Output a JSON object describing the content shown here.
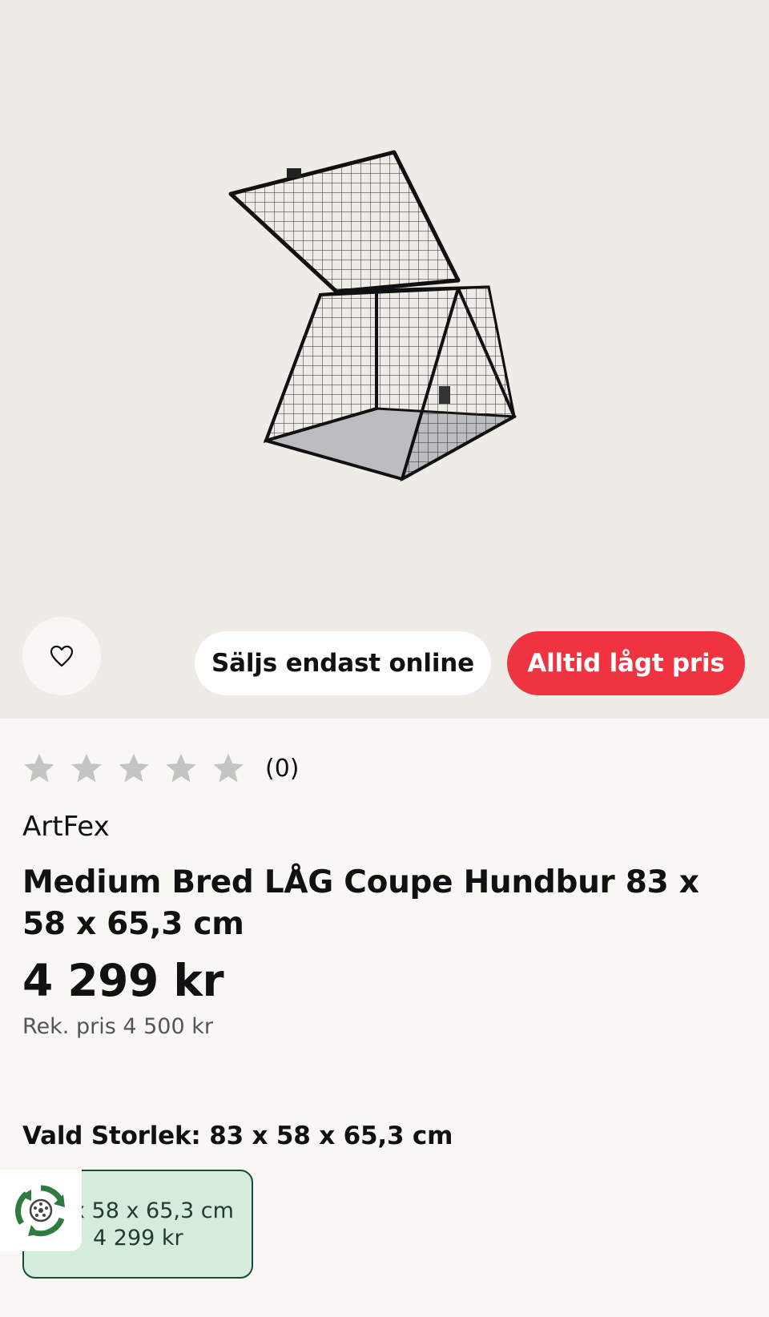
{
  "product": {
    "image_icon": "dog-cage-product-image",
    "rating_count": "(0)",
    "brand": "ArtFex",
    "title": "Medium Bred LÅG Coupe Hundbur 83 x 58 x 65,3 cm",
    "price": "4 299 kr",
    "recommended_price": "Rek. pris 4 500 kr"
  },
  "badges": {
    "online_only": "Säljs endast online",
    "always_low_price": "Alltid lågt pris"
  },
  "size": {
    "label": "Vald Storlek: 83 x 58 x 65,3 cm",
    "option_dims": "x 58 x 65,3 cm",
    "option_price": "4 299 kr"
  },
  "colors": {
    "accent_red": "#ef3340",
    "hero_bg": "#efebe6",
    "selected_size_bg": "#d5ecdc",
    "selected_size_border": "#1c4a36"
  }
}
